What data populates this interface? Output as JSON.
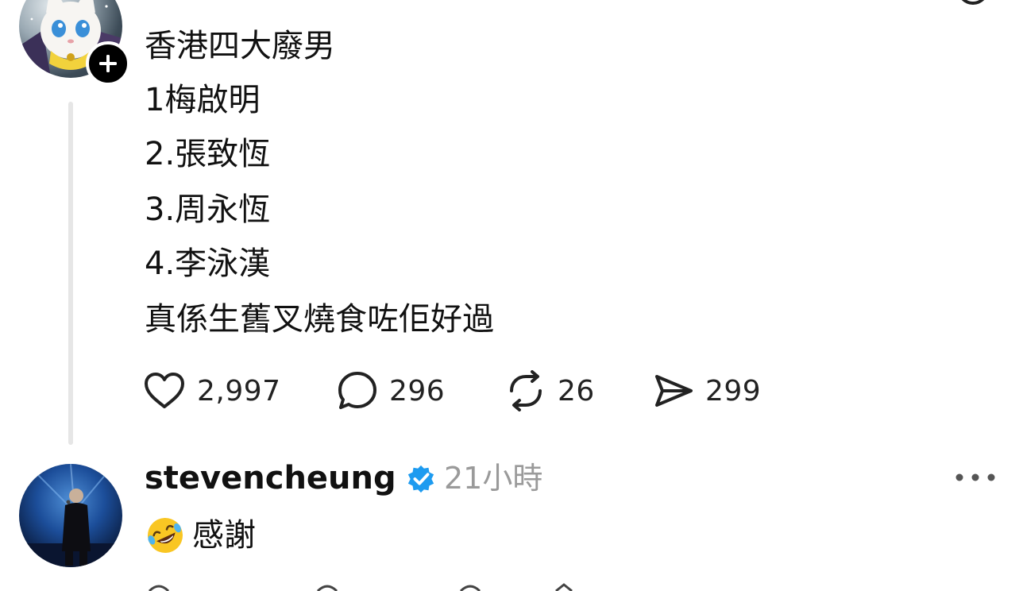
{
  "post": {
    "lines": [
      "香港四大廢男",
      "1梅啟明",
      "2.張致恆",
      "3.周永恆",
      "4.李泳漢",
      "真係生舊叉燒食咗佢好過"
    ],
    "actions": {
      "likes": "2,997",
      "comments": "296",
      "reposts": "26",
      "shares": "299"
    }
  },
  "reply": {
    "username": "stevencheung",
    "verified": true,
    "timestamp": "21小時",
    "text": "感謝",
    "emoji": "rolling-on-floor-laughing"
  },
  "colors": {
    "verified_blue": "#1d9bf0",
    "thread_line": "#e6e6e6",
    "muted_text": "#9a9a9a"
  }
}
